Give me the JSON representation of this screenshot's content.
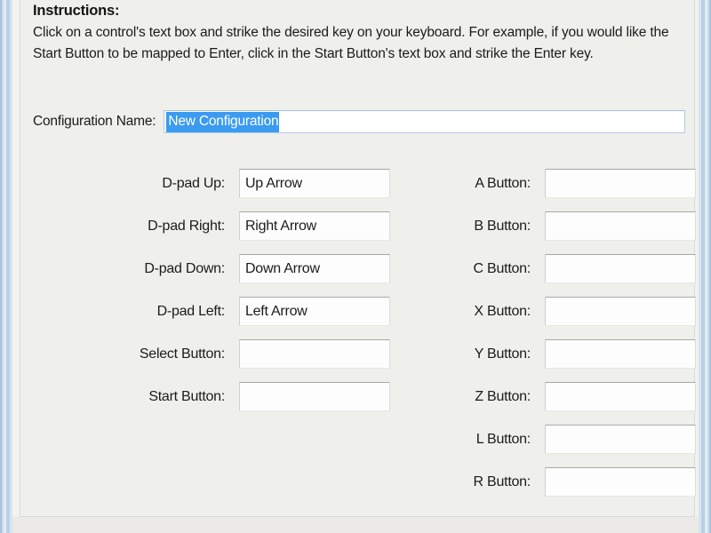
{
  "instructions": {
    "title": "Instructions:",
    "body": "Click on a control's text box and strike the desired key on your keyboard. For example, if you would like the Start Button to be mapped to Enter, click in the Start Button's text box and strike the Enter key."
  },
  "configuration": {
    "label": "Configuration Name:",
    "value": "New Configuration",
    "selected": true,
    "selection_color": "#3b9bf0",
    "selection_text_color": "#ffffff"
  },
  "mappings": {
    "left_column": [
      {
        "label": "D-pad Up:",
        "value": "Up Arrow"
      },
      {
        "label": "D-pad Right:",
        "value": "Right Arrow"
      },
      {
        "label": "D-pad Down:",
        "value": "Down Arrow"
      },
      {
        "label": "D-pad Left:",
        "value": "Left Arrow"
      },
      {
        "label": "Select Button:",
        "value": ""
      },
      {
        "label": "Start Button:",
        "value": ""
      }
    ],
    "right_column": [
      {
        "label": "A Button:",
        "value": ""
      },
      {
        "label": "B Button:",
        "value": ""
      },
      {
        "label": "C Button:",
        "value": ""
      },
      {
        "label": "X Button:",
        "value": ""
      },
      {
        "label": "Y Button:",
        "value": ""
      },
      {
        "label": "Z Button:",
        "value": ""
      },
      {
        "label": "L Button:",
        "value": ""
      },
      {
        "label": "R Button:",
        "value": ""
      }
    ]
  },
  "theme": {
    "form_background": "#efefec",
    "frame_glass": "#b9d0e6",
    "text_color": "#1b1b1b",
    "field_background": "#fdfdfd"
  }
}
